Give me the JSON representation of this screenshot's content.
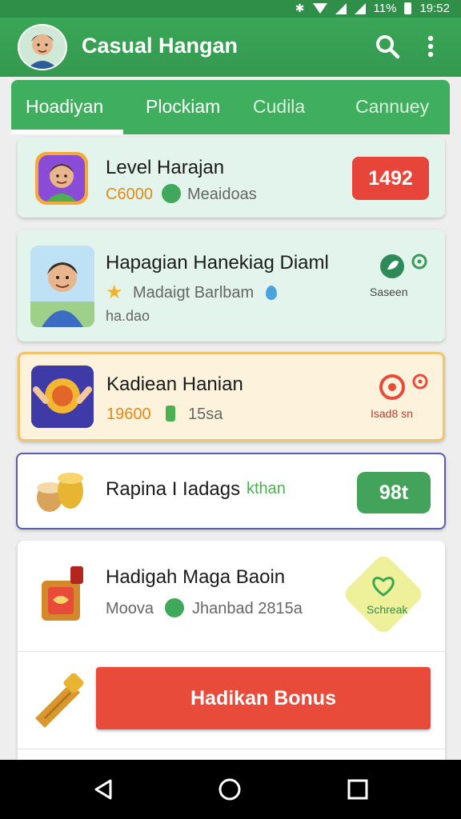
{
  "status_bar": {
    "battery_text": "11%",
    "time": "19:52",
    "icons": [
      "bluetooth-icon",
      "wifi-icon",
      "signal-icon",
      "signal-icon",
      "battery-icon"
    ]
  },
  "app_bar": {
    "title": "Casual Hangan",
    "icons": [
      "avatar",
      "search-icon",
      "more-vert-icon"
    ]
  },
  "tabs": [
    {
      "label": "Hoadiyan",
      "active": true
    },
    {
      "label": "Plockiam",
      "active": false
    },
    {
      "label": "Cudila",
      "active": false
    },
    {
      "label": "Cannuey",
      "active": false
    }
  ],
  "items": [
    {
      "title": "Level Harajan",
      "value": "C6000",
      "meta": "Meaidoas",
      "badge": "1492"
    },
    {
      "title": "Hapagian Hanekiag Diaml",
      "meta": "Madaigt Barlbam",
      "extra": "ha.dao",
      "side_label": "Saseen"
    },
    {
      "title": "Kadiean Hanian",
      "value": "19600",
      "meta": "15sa",
      "side_label": "Isad8 sn"
    },
    {
      "title": "Rapina I Iadags",
      "tag": "kthan",
      "badge": "98t"
    },
    {
      "title": "Hadigah Maga Baoin",
      "meta_left": "Moova",
      "meta_right": "Jhanbad 2815a",
      "side_label": "Schreak"
    }
  ],
  "bonus_button": {
    "label": "Hadikan Bonus"
  },
  "nav": [
    "back-icon",
    "home-icon",
    "recents-icon"
  ],
  "colors": {
    "primary": "#3aa657",
    "accent_red": "#e8453a",
    "accent_gold": "#e28a18",
    "card_mint": "#e3f4ec",
    "card_cream": "#fdf3dc"
  }
}
